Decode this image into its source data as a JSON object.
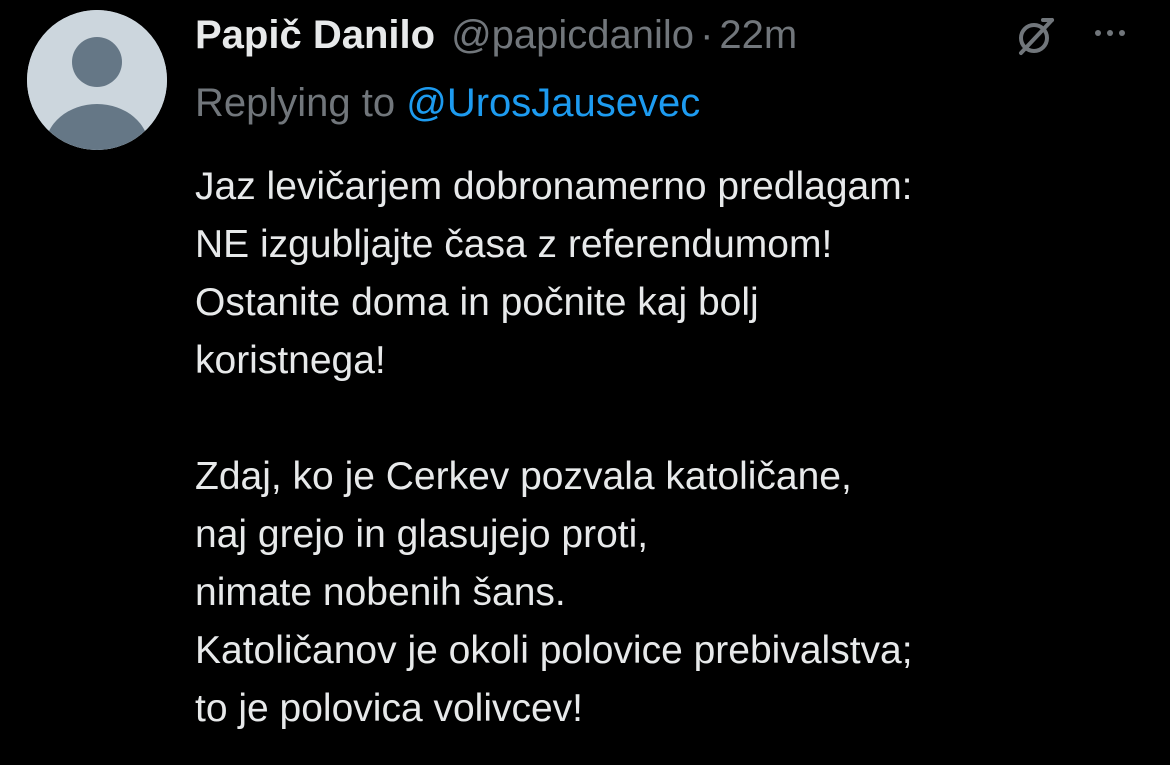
{
  "tweet": {
    "author": {
      "display_name": "Papič Danilo",
      "handle": "@papicdanilo",
      "avatar_icon": "default-avatar-icon"
    },
    "separator": "·",
    "time": "22m",
    "reply": {
      "prefix": "Replying to ",
      "mention": "@UrosJausevec"
    },
    "body": {
      "paragraph1": [
        "Jaz levičarjem dobronamerno predlagam:",
        "NE izgubljajte časa z referendumom!",
        "Ostanite doma in počnite kaj bolj",
        "koristnega!"
      ],
      "paragraph2": [
        "Zdaj, ko je Cerkev pozvala katoličane,",
        "naj grejo in glasujejo proti,",
        "nimate nobenih šans.",
        "Katoličanov je okoli polovice prebivalstva;",
        "to je polovica volivcev!"
      ]
    },
    "icons": {
      "grok": "grok-icon",
      "more": "more-options-icon"
    }
  },
  "colors": {
    "background": "#000000",
    "primary_text": "#e7e9ea",
    "secondary_text": "#71767b",
    "link": "#1d9bf0",
    "avatar_bg": "#ccd6dd",
    "avatar_fg": "#657786"
  }
}
